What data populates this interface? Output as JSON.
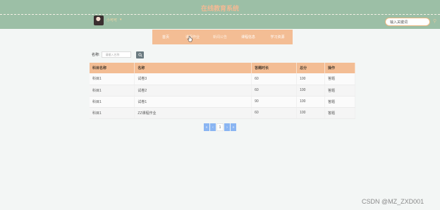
{
  "header": {
    "site_title": "在线教育系统",
    "username": "小可可",
    "user_caret": "▾",
    "search_placeholder": "输入关键词"
  },
  "nav": {
    "items": [
      {
        "label": "首页"
      },
      {
        "label": "课程作业"
      },
      {
        "label": "新闻公告"
      },
      {
        "label": "课程信息"
      },
      {
        "label": "学习资源"
      }
    ]
  },
  "filter": {
    "label": "名称:",
    "placeholder": "请输入名称"
  },
  "table": {
    "headers": [
      "科目名称",
      "名称",
      "答题时长",
      "总分",
      "操作"
    ],
    "rows": [
      [
        "科目1",
        "试卷3",
        "60",
        "100",
        "答题"
      ],
      [
        "科目1",
        "试卷2",
        "60",
        "100",
        "答题"
      ],
      [
        "科目1",
        "试卷1",
        "90",
        "100",
        "答题"
      ],
      [
        "科目1",
        "ZZ课程作业",
        "60",
        "100",
        "答题"
      ]
    ]
  },
  "pager": {
    "first": "«",
    "prev": "‹",
    "current": "1",
    "next": "›",
    "last": "»"
  },
  "watermark": "CSDN @MZ_ZXD001",
  "colors": {
    "header_bg": "#9cbfa6",
    "nav_bg": "#f3bd94",
    "title_color": "#f3b994",
    "pager_blue": "#8ab5f2"
  }
}
